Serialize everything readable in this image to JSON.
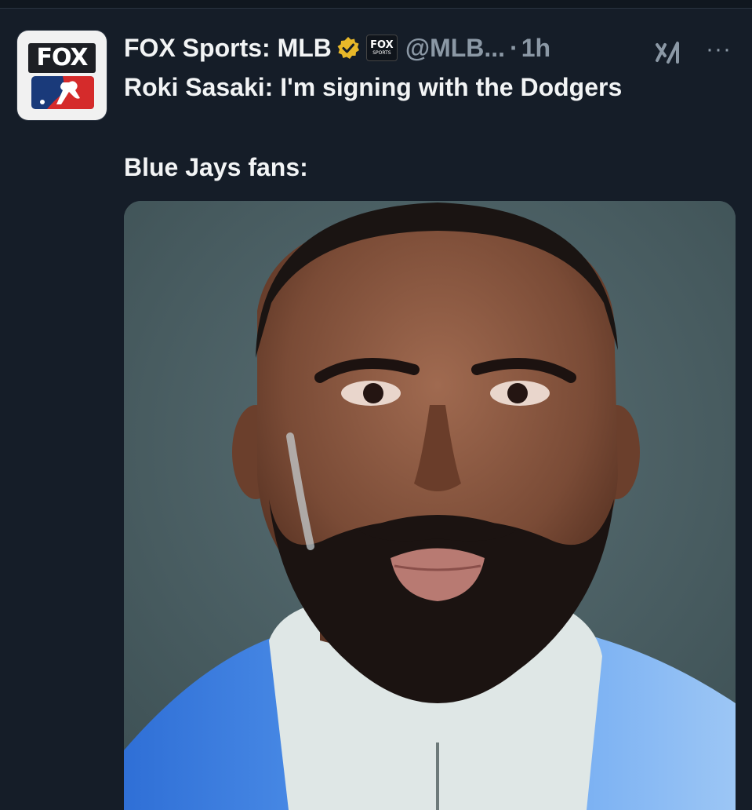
{
  "tweet": {
    "avatar": {
      "logo_text": "FOX",
      "icon": "fox-mlb-logo"
    },
    "display_name": "FOX Sports: MLB",
    "verified_icon": "verified-gold-badge",
    "affiliate": {
      "line1": "FOX",
      "line2": "SPORTS"
    },
    "handle": "@MLB...",
    "separator": "·",
    "time": "1h",
    "grok_icon": "grok-icon",
    "more_icon": "more-options-icon",
    "text_line1": "Roki Sasaki: I'm signing with the Dodgers",
    "text_line2": "Blue Jays fans:",
    "media": {
      "kind": "photo",
      "subject": "portrait"
    }
  },
  "colors": {
    "background": "#151d28",
    "text": "#f2f4f5",
    "muted": "#8b98a5",
    "verified_gold": "#e8b829"
  }
}
